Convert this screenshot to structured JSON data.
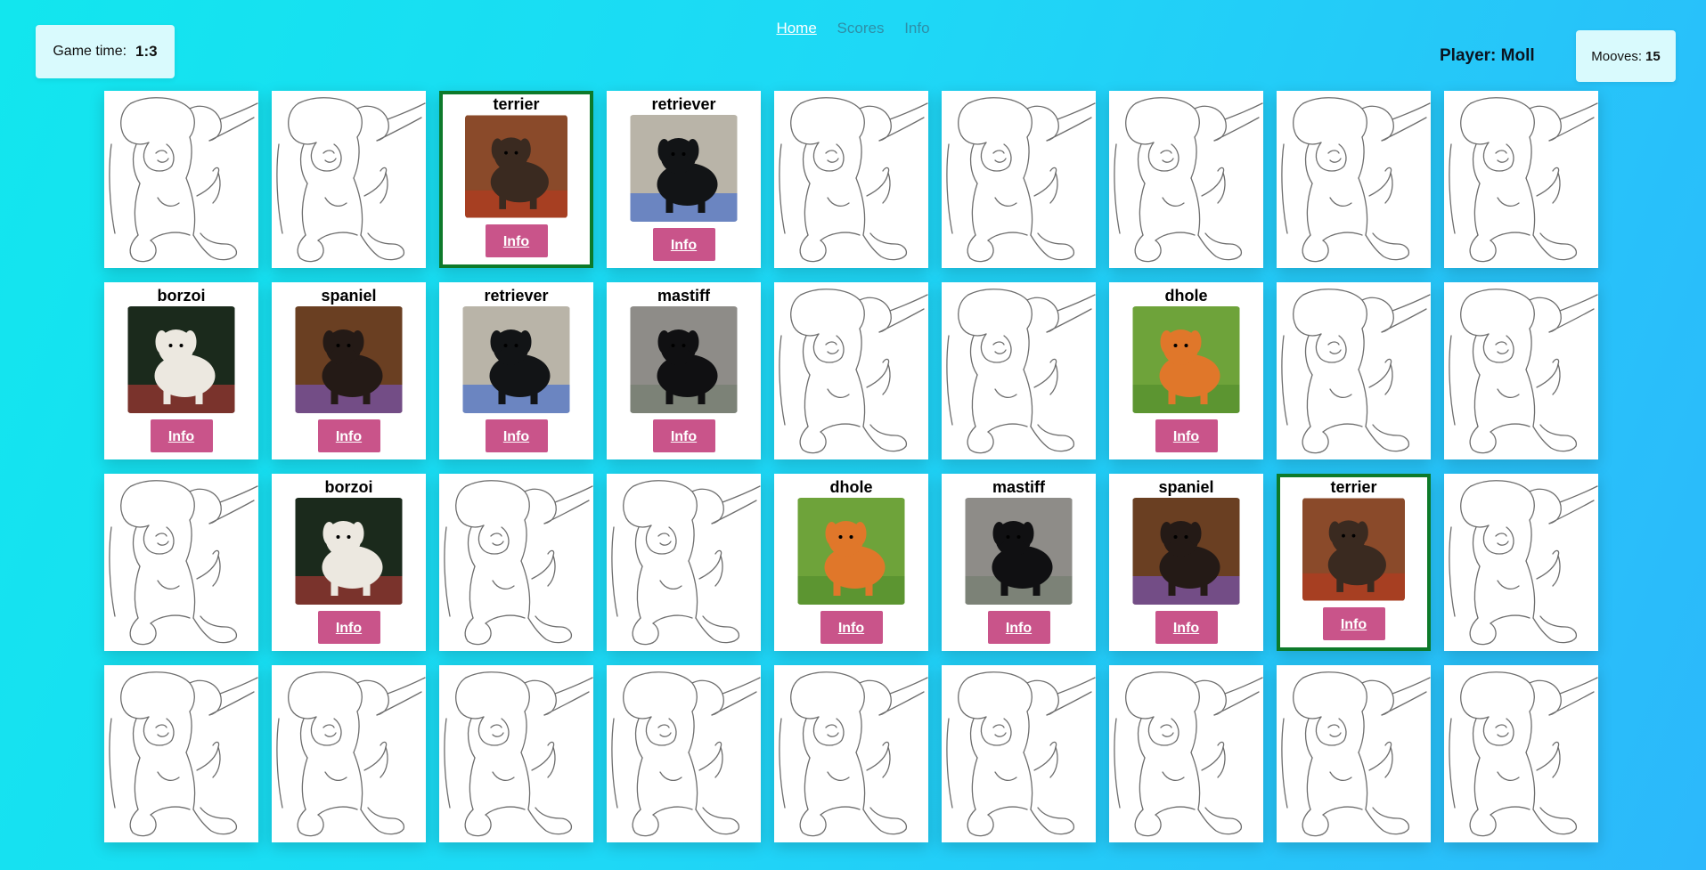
{
  "nav": {
    "home": "Home",
    "scores": "Scores",
    "info": "Info"
  },
  "game_time": {
    "label": "Game time:",
    "value": "1:3"
  },
  "player": {
    "label": "Player: Moll"
  },
  "moves": {
    "label": "Mooves:",
    "value": "15"
  },
  "info_label": "Info",
  "breeds": {
    "terrier": {
      "bg": "#8a4a2a",
      "dog": "#3a2a20",
      "accent": "#c0361c"
    },
    "retriever": {
      "bg": "#b9b4a8",
      "dog": "#121416",
      "accent": "#2c5fd6"
    },
    "borzoi": {
      "bg": "#1b2a1c",
      "dog": "#ece8e0",
      "accent": "#c93b3b"
    },
    "spaniel": {
      "bg": "#6a3f22",
      "dog": "#241a16",
      "accent": "#7a5ad8"
    },
    "mastiff": {
      "bg": "#8e8c88",
      "dog": "#101012",
      "accent": "#6e7a6a"
    },
    "dhole": {
      "bg": "#6ea33a",
      "dog": "#e0772a",
      "accent": "#4f8a2a"
    }
  },
  "rows": [
    [
      {
        "state": "back"
      },
      {
        "state": "back"
      },
      {
        "state": "matched",
        "breed": "terrier"
      },
      {
        "state": "open",
        "breed": "retriever"
      },
      {
        "state": "back"
      },
      {
        "state": "back"
      },
      {
        "state": "back"
      },
      {
        "state": "back"
      },
      {
        "state": "back"
      }
    ],
    [
      {
        "state": "open",
        "breed": "borzoi"
      },
      {
        "state": "open",
        "breed": "spaniel"
      },
      {
        "state": "open",
        "breed": "retriever"
      },
      {
        "state": "open",
        "breed": "mastiff"
      },
      {
        "state": "back"
      },
      {
        "state": "back"
      },
      {
        "state": "open",
        "breed": "dhole"
      },
      {
        "state": "back"
      },
      {
        "state": "back"
      }
    ],
    [
      {
        "state": "back"
      },
      {
        "state": "open",
        "breed": "borzoi"
      },
      {
        "state": "back"
      },
      {
        "state": "back"
      },
      {
        "state": "open",
        "breed": "dhole"
      },
      {
        "state": "open",
        "breed": "mastiff"
      },
      {
        "state": "open",
        "breed": "spaniel"
      },
      {
        "state": "matched",
        "breed": "terrier"
      },
      {
        "state": "back"
      }
    ],
    [
      {
        "state": "back"
      },
      {
        "state": "back"
      },
      {
        "state": "back"
      },
      {
        "state": "back"
      },
      {
        "state": "back"
      },
      {
        "state": "back"
      },
      {
        "state": "back"
      },
      {
        "state": "back"
      },
      {
        "state": "back"
      }
    ]
  ]
}
